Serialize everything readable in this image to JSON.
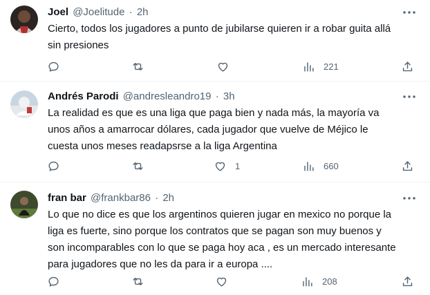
{
  "tweets": [
    {
      "name": "Joel",
      "handle": "@Joelitude",
      "time": "2h",
      "text": "Cierto, todos los jugadores a punto de jubilarse quieren ir a robar guita allá\nsin presiones",
      "likes": "",
      "views": "221"
    },
    {
      "name": "Andrés Parodi",
      "handle": "@andresleandro19",
      "time": "3h",
      "text": "La realidad es que es una liga que paga bien y nada más, la mayoría va\nunos años a amarrocar dólares, cada jugador que vuelve de Méjico le\ncuesta unos meses readapsrse a la liga Argentina",
      "likes": "1",
      "views": "660"
    },
    {
      "name": "fran bar",
      "handle": "@frankbar86",
      "time": "2h",
      "text": "Lo que no dice es que los argentinos quieren jugar en mexico no porque la\nliga es fuerte, sino porque los contratos que se pagan son muy buenos y\nson incomparables con lo que se paga hoy aca , es un mercado interesante\npara jugadores que no les da para ir a europa ....",
      "likes": "",
      "views": "208"
    }
  ],
  "separator": "·",
  "icons": {
    "reply": "reply-icon",
    "retweet": "retweet-icon",
    "like": "heart-icon",
    "views": "views-icon",
    "share": "share-icon",
    "more": "more-icon"
  },
  "colors": {
    "text": "#0f1419",
    "secondary": "#536471",
    "divider": "#eff3f4"
  }
}
